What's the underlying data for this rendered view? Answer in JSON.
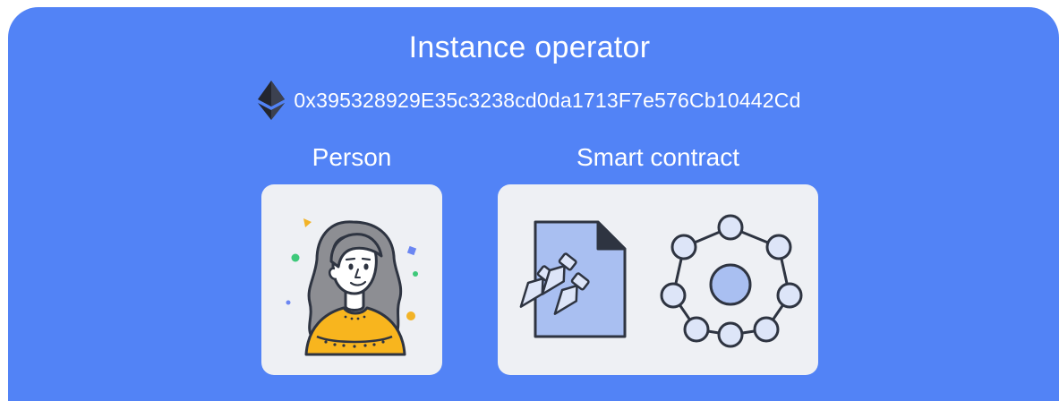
{
  "header": {
    "title": "Instance operator",
    "address": "0x395328929E35c3238cd0da1713F7e576Cb10442Cd",
    "address_icon": "ethereum-icon"
  },
  "options": [
    {
      "label": "Person",
      "icon": "person-illustration"
    },
    {
      "label": "Smart contract",
      "icons": [
        "signed-document-icon",
        "network-nodes-icon"
      ]
    }
  ],
  "colors": {
    "panel": "#5283f6",
    "card": "#eef0f4",
    "outline": "#2e3441",
    "doc_fill": "#a9bff1",
    "node_fill": "#dde5f8",
    "accent_yellow": "#f8b51e"
  }
}
